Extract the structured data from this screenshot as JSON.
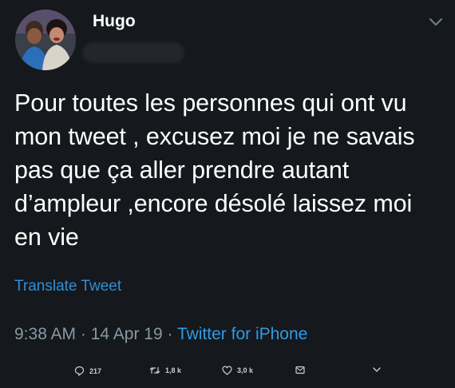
{
  "header": {
    "display_name": "Hugo",
    "menu_icon": "chevron-down-icon",
    "avatar_icon": "profile-photo"
  },
  "tweet": {
    "text": "Pour toutes les personnes qui ont vu\nmon tweet , excusez moi je ne savais\npas que ça aller prendre autant\nd’ampleur ,encore désolé laissez moi\nen vie",
    "translate_label": "Translate Tweet",
    "time": "9:38 AM",
    "separator": " · ",
    "date": "14 Apr 19",
    "source": "Twitter for iPhone"
  },
  "actions": {
    "reply_count": "217",
    "retweet_count": "1,8 k",
    "like_count": "3,0 k"
  },
  "colors": {
    "background": "#15181c",
    "link": "#2f8fd8",
    "muted": "#8899a6"
  }
}
